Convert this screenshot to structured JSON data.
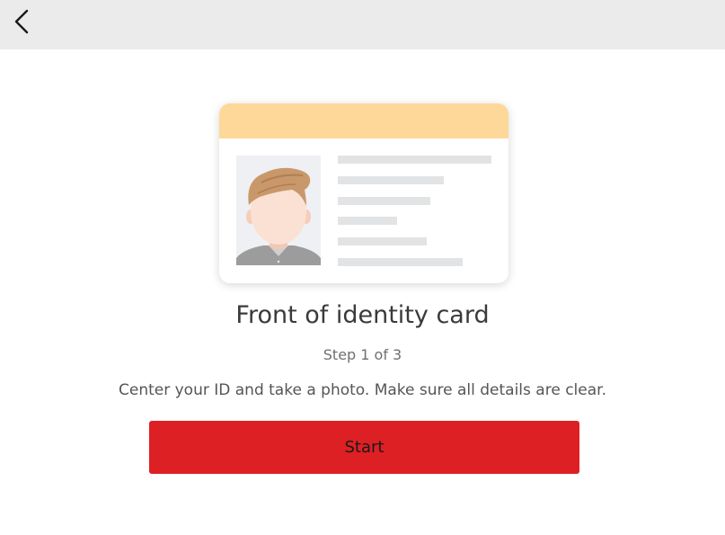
{
  "header": {
    "back_icon": "chevron-left-icon"
  },
  "card_illustration": {
    "band_color": "#fdd899",
    "avatar_icon": "person-avatar-icon",
    "placeholder_line_count": 6
  },
  "main": {
    "title": "Front of identity card",
    "step": "Step 1 of 3",
    "instruction": "Center your ID and take a photo. Make sure all details are clear.",
    "start_label": "Start",
    "start_color": "#dd2024"
  }
}
